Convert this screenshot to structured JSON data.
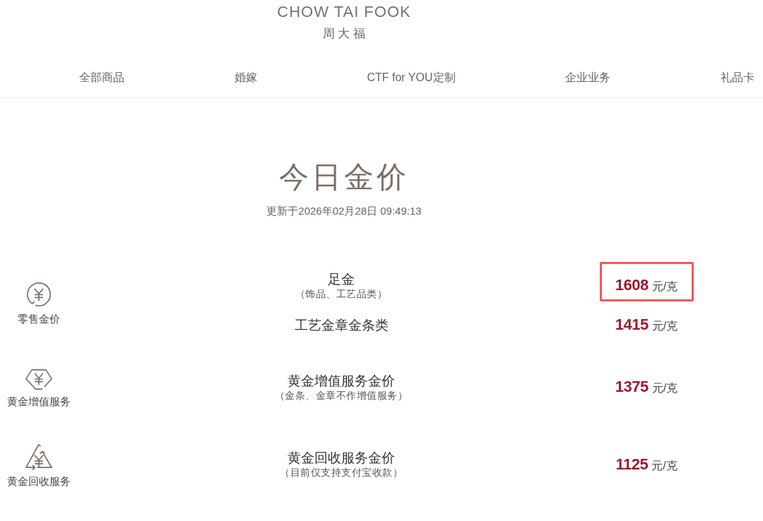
{
  "brand": {
    "name_en": "CHOW TAI FOOK",
    "name_zh": "周 大 福"
  },
  "nav": [
    {
      "label": "全部商品"
    },
    {
      "label": "婚嫁"
    },
    {
      "label": "CTF for YOU定制"
    },
    {
      "label": "企业业务"
    },
    {
      "label": "礼品卡"
    }
  ],
  "heading": {
    "title": "今日金价",
    "updated": "更新于2026年02月28日 09:49:13"
  },
  "groups": [
    {
      "kind": "circle",
      "label": "零售金价",
      "items": [
        {
          "name": "足金",
          "note": "（饰品、工艺品类）",
          "price": "1608",
          "unit": "元/克",
          "highlighted": true
        },
        {
          "name": "工艺金章金条类",
          "price": "1415",
          "unit": "元/克",
          "highlighted": false
        }
      ]
    },
    {
      "kind": "gem",
      "label": "黄金增值服务",
      "items": [
        {
          "name": "黄金增值服务金价",
          "note": "（金条、金章不作增值服务）",
          "price": "1375",
          "unit": "元/克",
          "highlighted": false
        }
      ]
    },
    {
      "kind": "recycle",
      "label": "黄金回收服务",
      "items": [
        {
          "name": "黄金回收服务金价",
          "note": "（目前仅支持支付宝收款）",
          "price": "1125",
          "unit": "元/克",
          "highlighted": false
        }
      ]
    }
  ]
}
